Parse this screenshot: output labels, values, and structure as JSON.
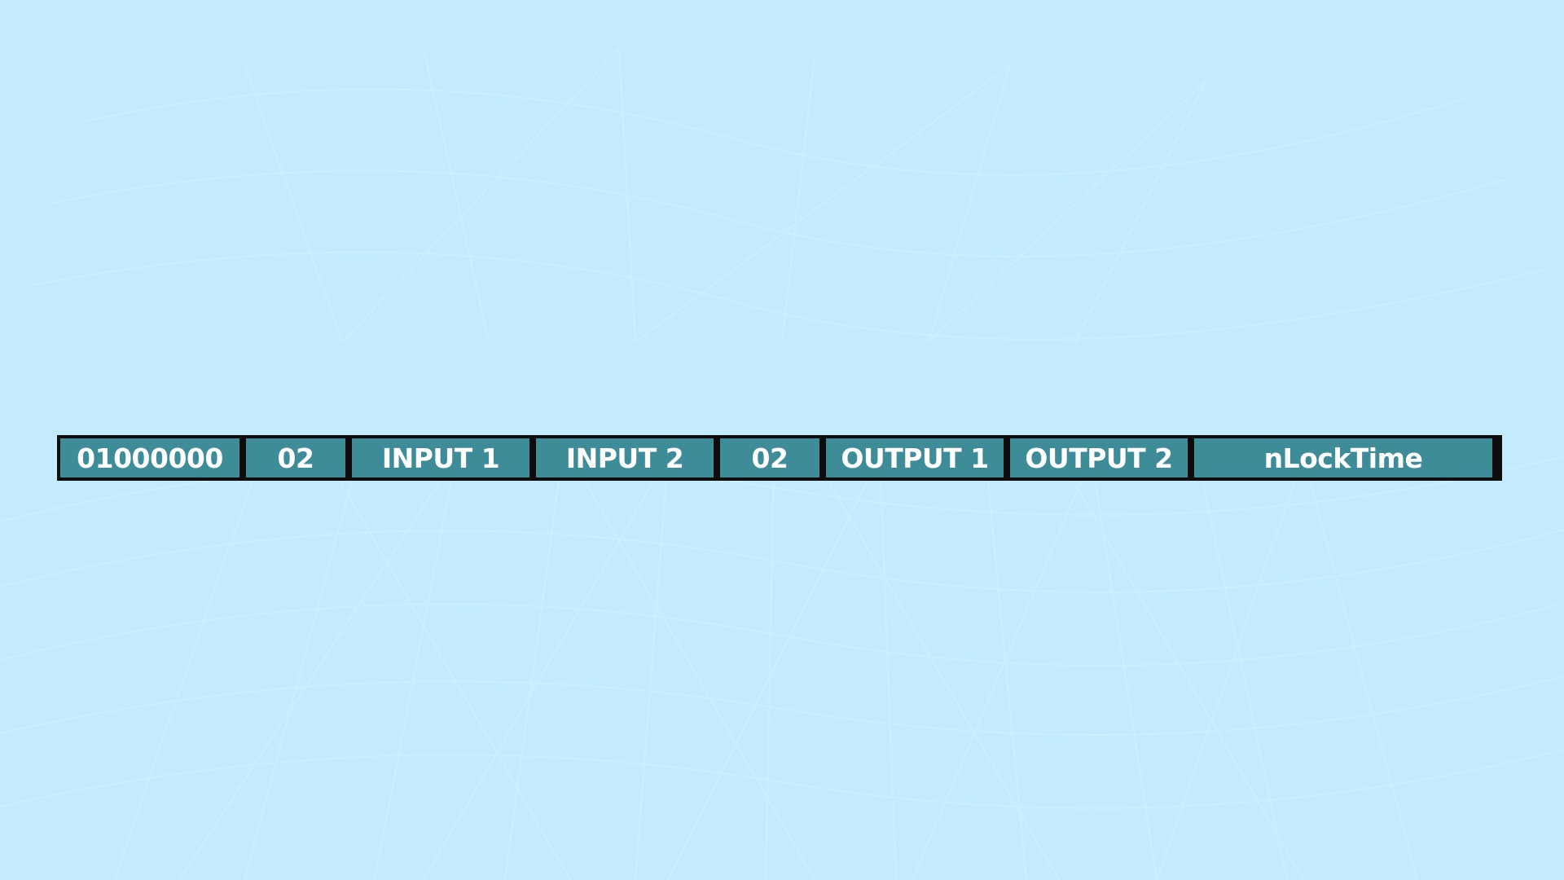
{
  "transaction": {
    "fields": {
      "version": "01000000",
      "input_count": "02",
      "input_1": "INPUT 1",
      "input_2": "INPUT 2",
      "output_count": "02",
      "output_1": "OUTPUT 1",
      "output_2": "OUTPUT 2",
      "locktime": "nLockTime"
    }
  },
  "colors": {
    "background": "#c3ebfd",
    "field_fill": "#3e8c97",
    "field_border": "#0d0d0d",
    "field_text": "#ffffff"
  }
}
